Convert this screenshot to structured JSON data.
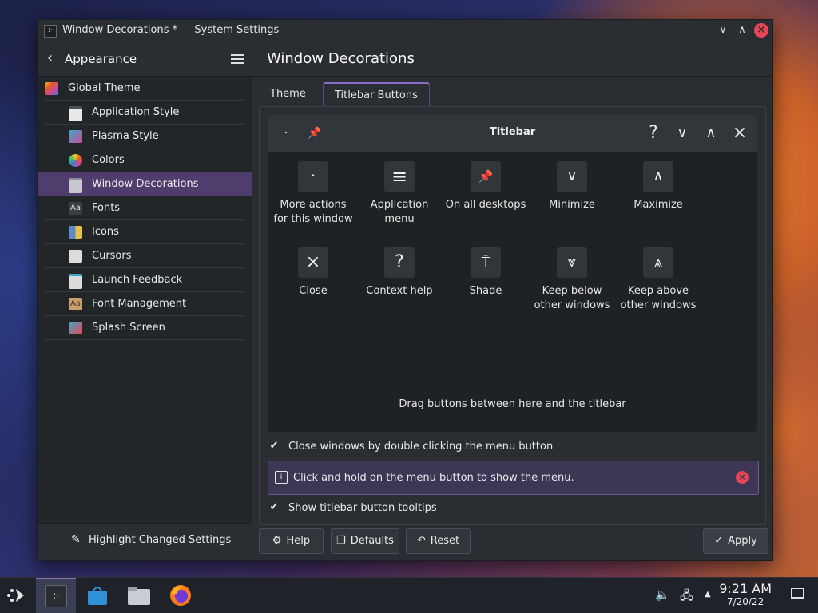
{
  "window": {
    "title": "Window Decorations * — System Settings",
    "minimize_glyph": "∨",
    "maximize_glyph": "∧",
    "close_glyph": "×"
  },
  "sidebar": {
    "back_glyph": "‹",
    "title": "Appearance",
    "items": [
      {
        "label": "Global Theme",
        "icon": "global-theme-icon",
        "color": "#c94d9e"
      },
      {
        "label": "Application Style",
        "icon": "application-style-icon",
        "color": "#d8d8d8"
      },
      {
        "label": "Plasma Style",
        "icon": "plasma-style-icon",
        "color": "#3aa9c7"
      },
      {
        "label": "Colors",
        "icon": "colors-icon",
        "color": "#f0a020"
      },
      {
        "label": "Window Decorations",
        "icon": "window-decorations-icon",
        "color": "#c8c8d0"
      },
      {
        "label": "Fonts",
        "icon": "fonts-icon",
        "color": "#555a60"
      },
      {
        "label": "Icons",
        "icon": "icons-icon",
        "color": "#5d8ac9"
      },
      {
        "label": "Cursors",
        "icon": "cursors-icon",
        "color": "#dcdcdc"
      },
      {
        "label": "Launch Feedback",
        "icon": "launch-feedback-icon",
        "color": "#dcdcdc"
      },
      {
        "label": "Font Management",
        "icon": "font-management-icon",
        "color": "#c8a070"
      },
      {
        "label": "Splash Screen",
        "icon": "splash-screen-icon",
        "color": "#3aa9c7"
      }
    ],
    "footer_label": "Highlight Changed Settings"
  },
  "main": {
    "title": "Window Decorations",
    "tabs": [
      {
        "label": "Theme"
      },
      {
        "label": "Titlebar Buttons"
      }
    ],
    "preview": {
      "titlebar_label": "Titlebar",
      "left_glyphs": [
        "⸱",
        "📌"
      ],
      "right_glyphs": [
        "?",
        "∨",
        "∧",
        "×"
      ],
      "buttons": [
        {
          "label": "More actions\nfor this window",
          "glyph": "⸱"
        },
        {
          "label": "Application\nmenu",
          "glyph": "≡"
        },
        {
          "label": "On all desktops",
          "glyph": "📌"
        },
        {
          "label": "Minimize",
          "glyph": "∨"
        },
        {
          "label": "Maximize",
          "glyph": "∧"
        },
        {
          "label": "Close",
          "glyph": "×"
        },
        {
          "label": "Context help",
          "glyph": "?"
        },
        {
          "label": "Shade",
          "glyph": "⍑"
        },
        {
          "label": "Keep below\nother windows",
          "glyph": "⩔"
        },
        {
          "label": "Keep above\nother windows",
          "glyph": "⩓"
        }
      ],
      "drag_hint": "Drag buttons between here and the titlebar"
    },
    "close_on_double_click": {
      "label": "Close windows by double clicking the menu button",
      "checked": true,
      "glyph": "✔"
    },
    "info_message": "Click and hold on the menu button to show the menu.",
    "info_glyph": "i",
    "info_close_glyph": "×",
    "show_tooltips": {
      "label": "Show titlebar button tooltips",
      "checked": true,
      "glyph": "✔"
    },
    "buttons": {
      "help": "Help",
      "defaults": "Defaults",
      "reset": "Reset",
      "apply": "Apply"
    },
    "button_glyphs": {
      "help": "⚙",
      "defaults": "❐",
      "reset": "↶",
      "apply": "✓"
    }
  },
  "taskbar": {
    "time": "9:21 AM",
    "date": "7/20/22",
    "tray_up_glyph": "▲"
  },
  "colors": {
    "accent": "#8a6cc4",
    "selection": "#4f3d6e",
    "close_red": "#e84557"
  }
}
